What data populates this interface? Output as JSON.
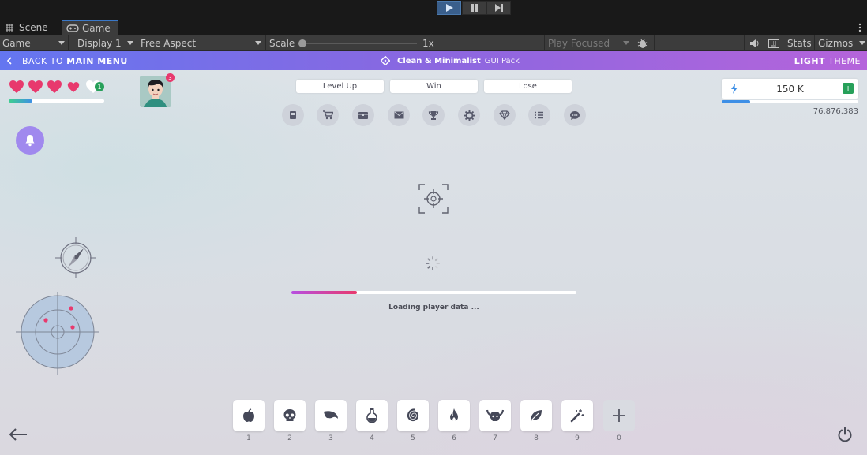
{
  "unity": {
    "tabs": {
      "scene": "Scene",
      "game": "Game"
    },
    "toolbar": {
      "display_mode": "Game",
      "display": "Display 1",
      "aspect": "Free Aspect",
      "scale_label": "Scale",
      "scale_value": "1x",
      "play_mode": "Play Focused",
      "stats": "Stats",
      "gizmos": "Gizmos"
    }
  },
  "header": {
    "back_prefix": "BACK TO",
    "back_main": "MAIN MENU",
    "pack_bold": "Clean & Minimalist",
    "pack_light": "GUI Pack",
    "theme_bold": "LIGHT",
    "theme_light": "THEME"
  },
  "player": {
    "hearts_full": 4,
    "heart_extra_badge": "1",
    "health_fraction": 0.25,
    "avatar_badge": "3"
  },
  "buttons": {
    "level_up": "Level Up",
    "win": "Win",
    "lose": "Lose"
  },
  "icon_row": [
    "book-icon",
    "cart-icon",
    "chest-icon",
    "mail-icon",
    "trophy-icon",
    "gear-icon",
    "diamond-icon",
    "list-icon",
    "chat-icon"
  ],
  "energy": {
    "value": "150 K",
    "badge": "I",
    "fill": 0.21,
    "sub_value": "76.876.383"
  },
  "loading": {
    "text": "Loading player data ...",
    "progress": 0.23
  },
  "inventory": [
    {
      "icon": "apple-icon",
      "num": "1"
    },
    {
      "icon": "skull-icon",
      "num": "2"
    },
    {
      "icon": "wing-icon",
      "num": "3"
    },
    {
      "icon": "potion-icon",
      "num": "4"
    },
    {
      "icon": "spiral-icon",
      "num": "5"
    },
    {
      "icon": "fire-icon",
      "num": "6"
    },
    {
      "icon": "horned-helmet-icon",
      "num": "7"
    },
    {
      "icon": "leaf-icon",
      "num": "8"
    },
    {
      "icon": "magic-wand-icon",
      "num": "9"
    },
    {
      "icon": "plus-icon",
      "num": "0"
    }
  ],
  "colors": {
    "accent_blue": "#3e8fe6",
    "heart_pink": "#e8396d",
    "badge_green": "#27a05a",
    "bell_purple": "#a089ee",
    "loading_pink": "#d94a8a",
    "radar_blue": "#b7c9df"
  }
}
